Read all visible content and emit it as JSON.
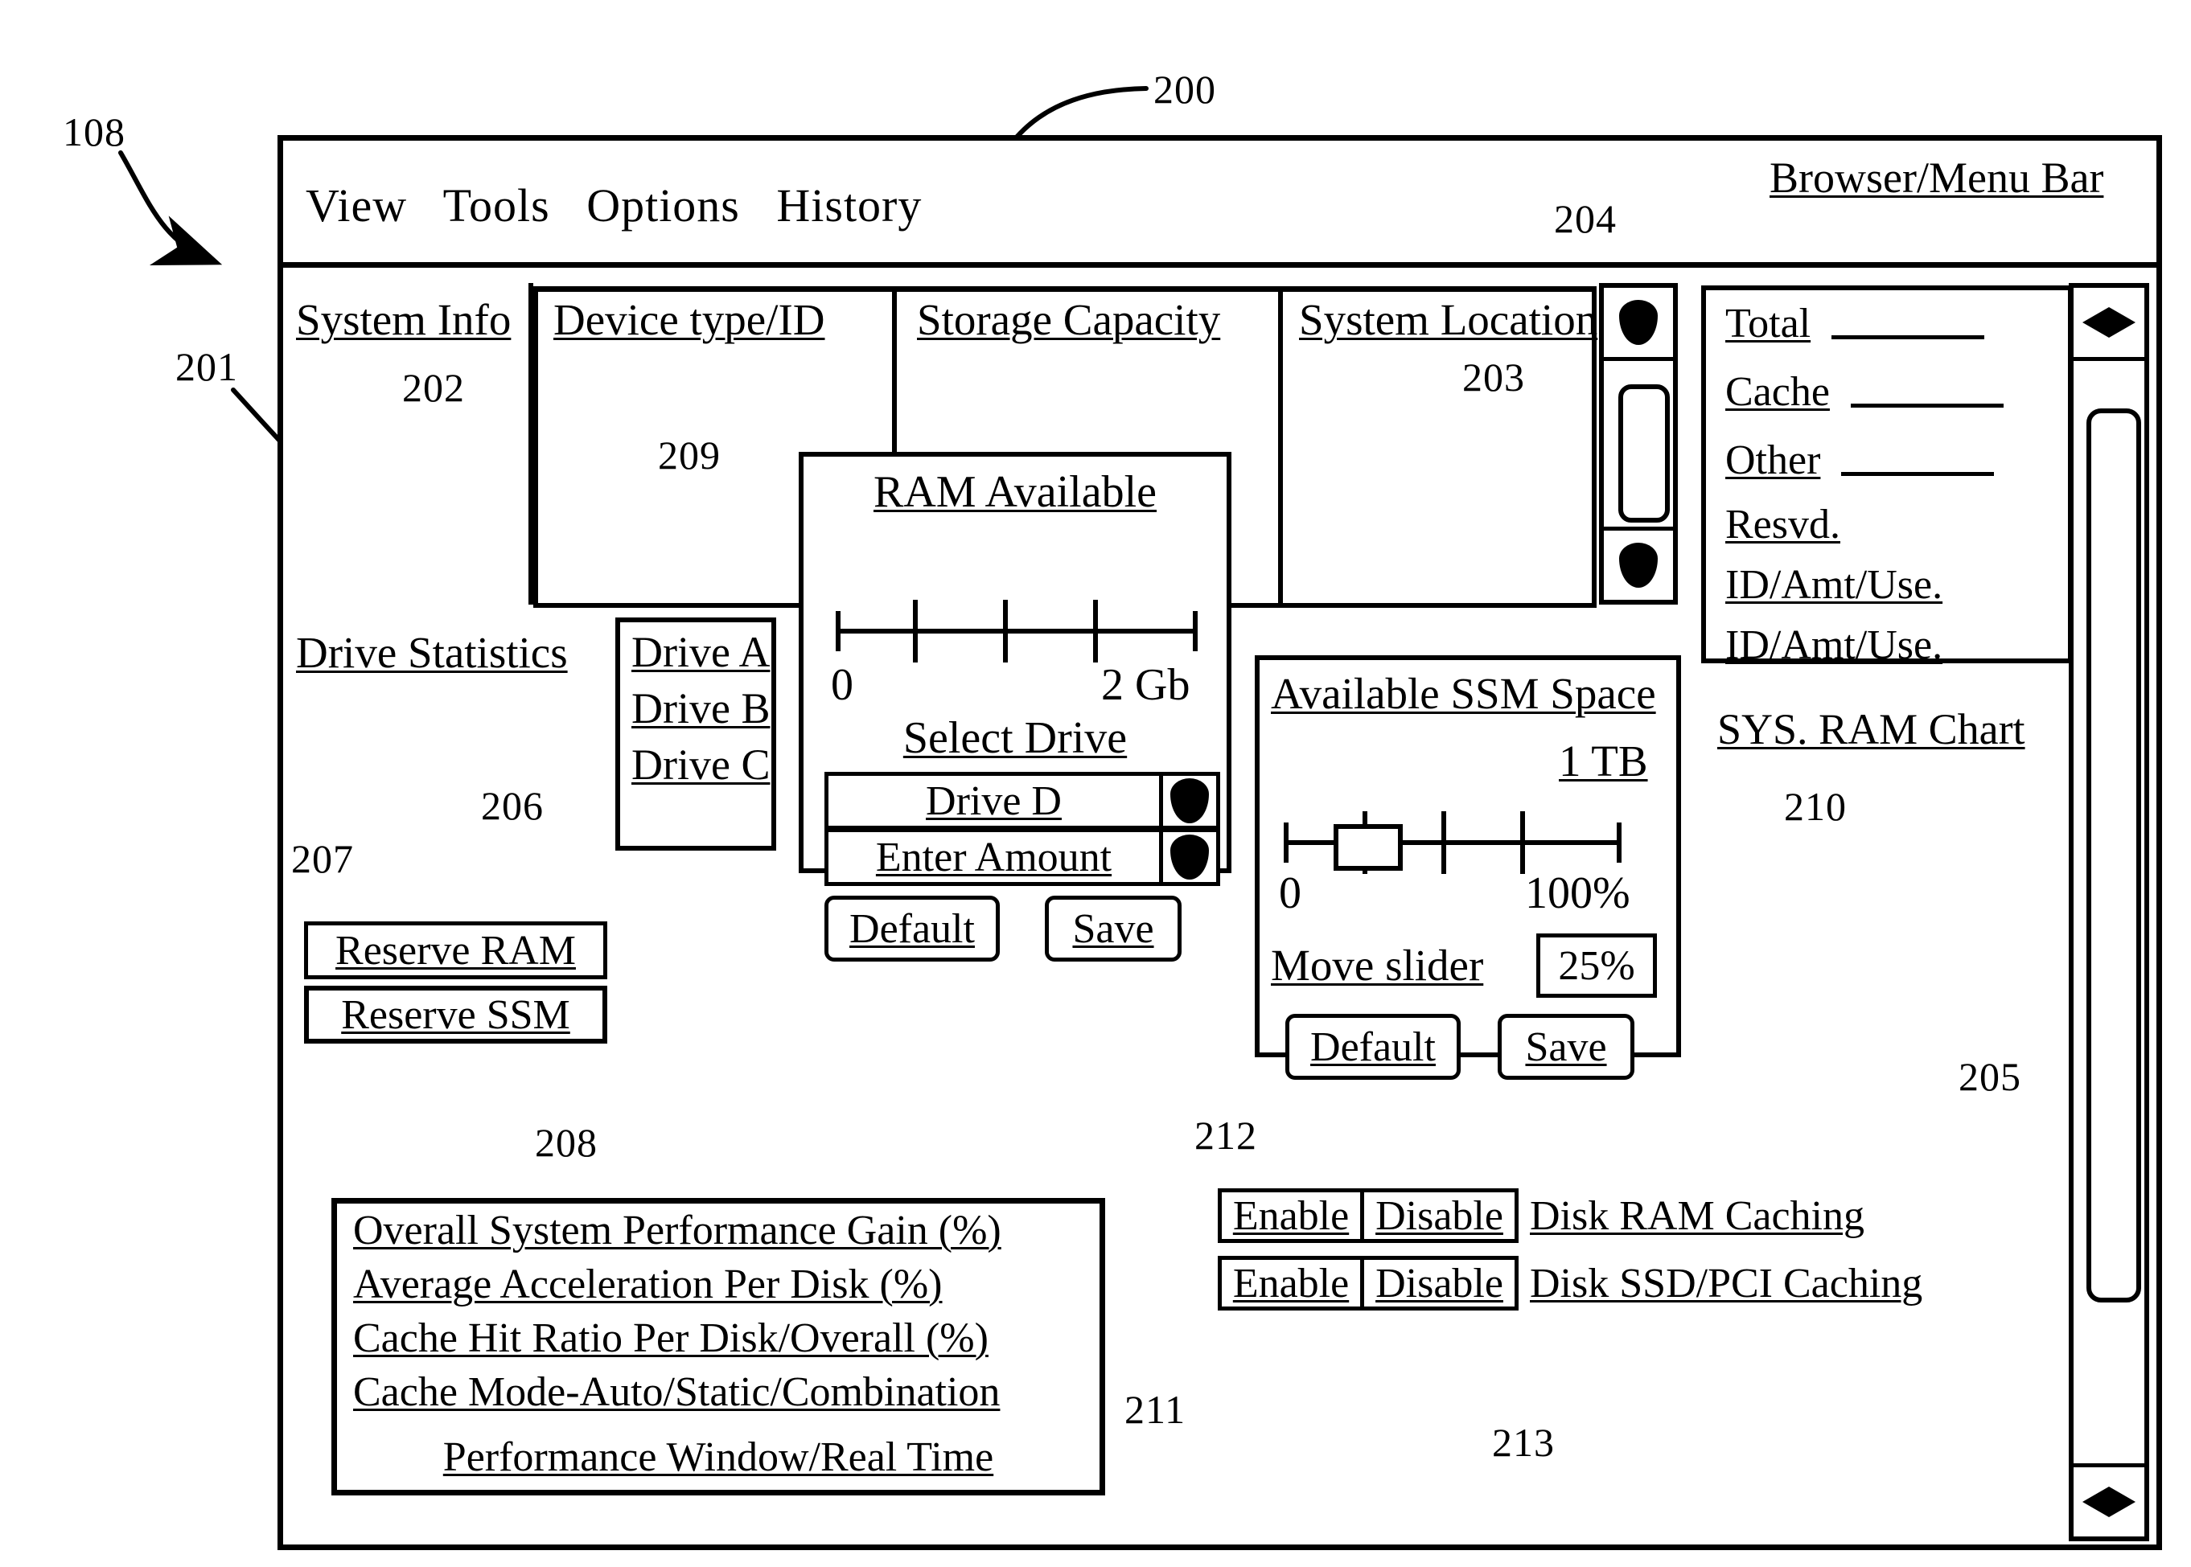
{
  "figure": {
    "reference_numerals": [
      {
        "id": "r108",
        "text": "108"
      },
      {
        "id": "r200",
        "text": "200"
      },
      {
        "id": "r201",
        "text": "201"
      },
      {
        "id": "r202",
        "text": "202"
      },
      {
        "id": "r203",
        "text": "203"
      },
      {
        "id": "r204",
        "text": "204"
      },
      {
        "id": "r205",
        "text": "205"
      },
      {
        "id": "r206",
        "text": "206"
      },
      {
        "id": "r207",
        "text": "207"
      },
      {
        "id": "r208",
        "text": "208"
      },
      {
        "id": "r209",
        "text": "209"
      },
      {
        "id": "r210",
        "text": "210"
      },
      {
        "id": "r211",
        "text": "211"
      },
      {
        "id": "r212",
        "text": "212"
      },
      {
        "id": "r213",
        "text": "213"
      }
    ]
  },
  "menu_bar": {
    "items": [
      "View",
      "Tools",
      "Options",
      "History"
    ],
    "caption": "Browser/Menu Bar"
  },
  "headers": {
    "system_info": "System Info",
    "device_type_id": "Device type/ID",
    "storage_capacity": "Storage Capacity",
    "system_location": "System Location"
  },
  "ram_chart": {
    "rows": [
      {
        "label": "Total",
        "value": ""
      },
      {
        "label": "Cache",
        "value": ""
      },
      {
        "label": "Other",
        "value": ""
      },
      {
        "label": "Resvd.",
        "value": null
      },
      {
        "label": "ID/Amt/Use.",
        "value": null
      },
      {
        "label": "ID/Amt/Use.",
        "value": null
      }
    ],
    "caption": "SYS. RAM Chart"
  },
  "drive_statistics": {
    "label": "Drive Statistics",
    "drives": [
      "Drive A",
      "Drive B",
      "Drive C"
    ]
  },
  "reserve_buttons": {
    "ram": "Reserve RAM",
    "ssm": "Reserve SSM"
  },
  "ram_dialog": {
    "title": "RAM Available",
    "scale_min": "0",
    "scale_max": "2 Gb",
    "select_drive_label": "Select Drive",
    "drive_value": "Drive D",
    "amount_value": "Enter Amount",
    "default_label": "Default",
    "save_label": "Save",
    "dropdown_icon": "chevron-down-icon"
  },
  "ssm_dialog": {
    "title": "Available SSM Space",
    "capacity": "1 TB",
    "scale_min": "0",
    "scale_max": "100%",
    "move_slider_label": "Move slider",
    "slider_value": "25%",
    "default_label": "Default",
    "save_label": "Save"
  },
  "performance_box": {
    "rows": [
      "Overall System Performance Gain (%)",
      "Average Acceleration Per Disk (%)",
      "Cache Hit Ratio Per Disk/Overall (%)",
      "Cache Mode-Auto/Static/Combination",
      "Performance Window/Real Time"
    ]
  },
  "caching_controls": [
    {
      "enable": "Enable",
      "disable": "Disable",
      "text": "Disk RAM Caching"
    },
    {
      "enable": "Enable",
      "disable": "Disable",
      "text": "Disk SSD/PCI Caching"
    }
  ],
  "chart_data": {
    "type": "table",
    "title": "SYS. RAM Chart",
    "categories": [
      "Total",
      "Cache",
      "Other",
      "Resvd.",
      "ID/Amt/Use.",
      "ID/Amt/Use."
    ],
    "values": [
      "",
      "",
      "",
      "",
      "",
      ""
    ],
    "xlabel": "",
    "ylabel": "",
    "sliders": [
      {
        "name": "RAM Available",
        "min": 0,
        "max": 2,
        "unit": "Gb",
        "ticks": 3,
        "value": null
      },
      {
        "name": "Available SSM Space",
        "min": 0,
        "max": 100,
        "unit": "%",
        "ticks": 3,
        "value": 25,
        "capacity": "1 TB"
      }
    ]
  },
  "colors": {
    "ink": "#000000",
    "paper": "#ffffff"
  }
}
